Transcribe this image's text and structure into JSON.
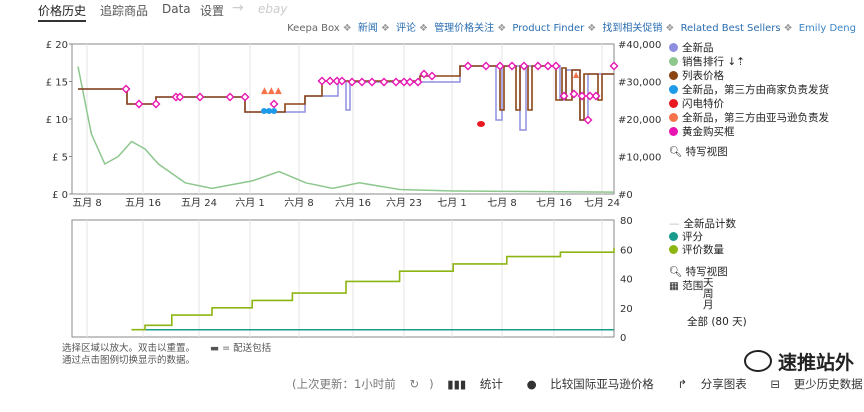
{
  "tabs": [
    "价格历史",
    "追踪商品",
    "Data",
    "设置",
    "→",
    "ebay"
  ],
  "toplinks": {
    "keepa": "Keepa Box",
    "links": [
      "新闻",
      "评论",
      "管理价格关注",
      "Product Finder",
      "找到相关促销",
      "Related Best Sellers"
    ],
    "user": "Emily Deng",
    "separator": "❖"
  },
  "legend_top": {
    "items": [
      {
        "label": "全新品",
        "color": "#8f8fe0"
      },
      {
        "label": "销售排行 ↓⇡",
        "color": "#8ec78e"
      },
      {
        "label": "列表价格",
        "color": "#8b4513"
      },
      {
        "label": "全新品，第三方由商家负责发货",
        "color": "#1e9be8"
      },
      {
        "label": "闪电特价",
        "color": "#e8191f"
      },
      {
        "label": "全新品，第三方由亚马逊负责发",
        "color": "#f5734b"
      },
      {
        "label": "黄金购买框",
        "color": "#e815b0"
      }
    ],
    "zoom": "特写视图"
  },
  "legend_bottom": {
    "items": [
      {
        "label": "全新品计数",
        "color": "#bbbbbb",
        "shape": "line"
      },
      {
        "label": "评分",
        "color": "#1a9c8c",
        "shape": "dot"
      },
      {
        "label": "评价数量",
        "color": "#8db512",
        "shape": "dot"
      }
    ],
    "zoom": "特写视图",
    "range_label": "范围",
    "ranges": [
      "天",
      "周",
      "月",
      "全部 (80 天)"
    ]
  },
  "note": {
    "line1": "选择区域以放大。双击以重置。",
    "shipping": "= 配送包括",
    "line2": "通过点击图例切换显示的数据。"
  },
  "bottom_bar": {
    "last_update": "(上次更新：1小时前",
    "stats": "统计",
    "compare": "比较国际亚马逊价格",
    "share": "分享图表",
    "less": "更少历史数据"
  },
  "watermark": "速推站外",
  "chart_data": [
    {
      "type": "line",
      "x_ticks": [
        "五月 8",
        "五月 16",
        "五月 24",
        "六月 1",
        "六月 8",
        "六月 16",
        "六月 23",
        "七月 1",
        "七月 8",
        "七月 16",
        "七月 24"
      ],
      "y_ticks_left": [
        "£ 20",
        "£ 15",
        "£ 10",
        "£ 5",
        "£ 0"
      ],
      "y_ticks_right": [
        "#40,000",
        "#30,000",
        "#20,000",
        "#10,000",
        "#0"
      ],
      "ylim": [
        0,
        20
      ],
      "ylim_right": [
        0,
        40000
      ],
      "series": [
        {
          "name": "列表价格",
          "x": [
            0,
            8,
            16,
            22,
            30,
            36,
            38,
            42,
            52,
            62,
            68,
            72,
            76,
            78,
            80
          ],
          "y": [
            14,
            12,
            13,
            13,
            11,
            11,
            13,
            15,
            15,
            15,
            16,
            17,
            17,
            15.5,
            16
          ]
        },
        {
          "name": "销售排行",
          "x": [
            0,
            2,
            4,
            6,
            8,
            10,
            12,
            16,
            20,
            26,
            30,
            34,
            38,
            42,
            48,
            56,
            64,
            72,
            80
          ],
          "y": [
            34000,
            16000,
            8000,
            10000,
            14000,
            12000,
            8000,
            3000,
            1500,
            3500,
            6000,
            3000,
            1500,
            3000,
            1200,
            800,
            700,
            600,
            500
          ]
        }
      ]
    },
    {
      "type": "line",
      "y_ticks_right": [
        "80",
        "60",
        "40",
        "20",
        "0"
      ],
      "ylim": [
        0,
        80
      ],
      "series": [
        {
          "name": "评价数量",
          "x": [
            8,
            10,
            14,
            20,
            26,
            32,
            40,
            48,
            56,
            64,
            72,
            80
          ],
          "y": [
            5,
            8,
            15,
            20,
            25,
            30,
            38,
            45,
            50,
            55,
            58,
            61
          ]
        },
        {
          "name": "评分",
          "x": [
            8,
            80
          ],
          "y": [
            5,
            5
          ]
        }
      ]
    }
  ]
}
